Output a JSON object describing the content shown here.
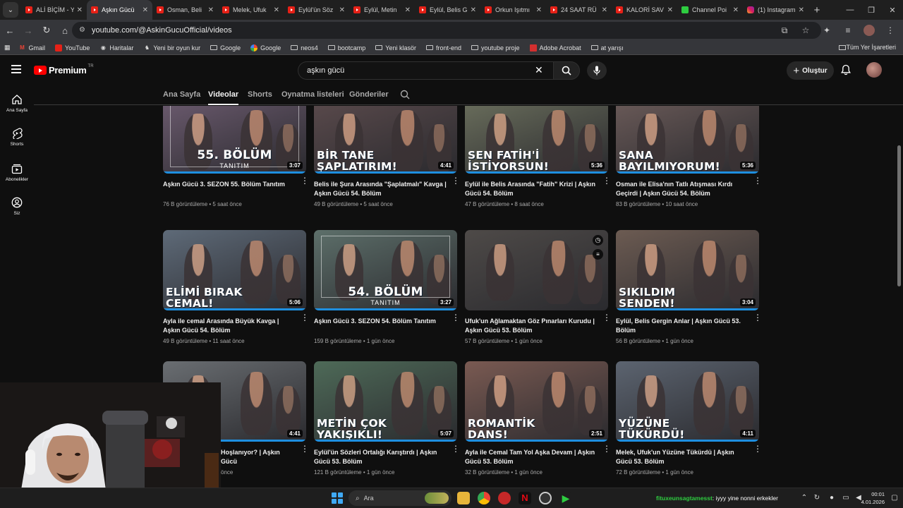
{
  "browser": {
    "tab_menu_glyph": "⌄",
    "tabs": [
      {
        "label": "ALİ BİÇİM - Y",
        "active": false,
        "icon": "youtube-icon"
      },
      {
        "label": "Aşkın Gücü",
        "active": true,
        "icon": "youtube-icon"
      },
      {
        "label": "Osman, Beli",
        "active": false,
        "icon": "youtube-icon"
      },
      {
        "label": "Melek, Ufuk",
        "active": false,
        "icon": "youtube-icon"
      },
      {
        "label": "Eylül'ün Söz",
        "active": false,
        "icon": "youtube-icon"
      },
      {
        "label": "Eylül, Metin",
        "active": false,
        "icon": "youtube-icon"
      },
      {
        "label": "Eylül, Belis G",
        "active": false,
        "icon": "youtube-icon"
      },
      {
        "label": "Orkun Işıtmı",
        "active": false,
        "icon": "youtube-icon"
      },
      {
        "label": "24 SAAT RÜ",
        "active": false,
        "icon": "youtube-icon"
      },
      {
        "label": "KALORİ SAV",
        "active": false,
        "icon": "youtube-icon"
      },
      {
        "label": "Channel Poi",
        "active": false,
        "icon": "kick-icon"
      },
      {
        "label": "(1) Instagram",
        "active": false,
        "icon": "instagram-icon"
      }
    ],
    "new_tab": "+",
    "url": "youtube.com/@AskinGucuOfficial/videos"
  },
  "bookmarks": {
    "items": [
      {
        "label": "Gmail",
        "icon": "gmail-icon"
      },
      {
        "label": "YouTube",
        "icon": "youtube-icon"
      },
      {
        "label": "Haritalar",
        "icon": "maps-icon"
      },
      {
        "label": "Yeni bir oyun kur",
        "icon": "game-icon"
      },
      {
        "label": "Google",
        "icon": "folder-icon"
      },
      {
        "label": "Google",
        "icon": "google-icon"
      },
      {
        "label": "neos4",
        "icon": "folder-icon"
      },
      {
        "label": "bootcamp",
        "icon": "folder-icon"
      },
      {
        "label": "Yeni klasör",
        "icon": "folder-icon"
      },
      {
        "label": "front-end",
        "icon": "folder-icon"
      },
      {
        "label": "youtube proje",
        "icon": "folder-icon"
      },
      {
        "label": "Adobe Acrobat",
        "icon": "pdf-icon"
      },
      {
        "label": "at yarışı",
        "icon": "folder-icon"
      }
    ],
    "all_bookmarks": "Tüm Yer İşaretleri"
  },
  "youtube": {
    "logo_text": "Premium",
    "logo_country": "TR",
    "search_query": "aşkın gücü",
    "create_label": "Oluştur",
    "guide": [
      {
        "label": "Ana Sayfa",
        "icon": "home-icon"
      },
      {
        "label": "Shorts",
        "icon": "shorts-icon"
      },
      {
        "label": "Abonelikler",
        "icon": "subscriptions-icon"
      },
      {
        "label": "Siz",
        "icon": "you-icon"
      }
    ],
    "channel_tabs": [
      "Ana Sayfa",
      "Videolar",
      "Shorts",
      "Oynatma listeleri",
      "Gönderiler"
    ],
    "active_channel_tab": "Videolar"
  },
  "videos": [
    {
      "overlay": "55. BÖLÜM",
      "overlay_sub": "TANITIM",
      "duration": "3:07",
      "title": "Aşkın Gücü 3. SEZON 55. Bölüm Tanıtım",
      "views": "76 B görüntüleme",
      "age": "5 saat önce",
      "bg": "#6b5a6e"
    },
    {
      "overlay": "BİR TANE ŞAPLATIRIM!",
      "overlay_sub": "",
      "duration": "4:41",
      "title": "Belis ile Şura Arasında \"Şaplatmalı\" Kavga | Aşkın Gücü 54. Bölüm",
      "views": "49 B görüntüleme",
      "age": "5 saat önce",
      "bg": "#5a4a4c"
    },
    {
      "overlay": "SEN FATİH'İ İSTİYORSUN!",
      "overlay_sub": "",
      "duration": "5:36",
      "title": "Eylül ile Belis Arasında \"Fatih\" Krizi | Aşkın Gücü 54. Bölüm",
      "views": "47 B görüntüleme",
      "age": "8 saat önce",
      "bg": "#6a6e5c"
    },
    {
      "overlay": "SANA BAYILMIYORUM!",
      "overlay_sub": "",
      "duration": "5:36",
      "title": "Osman ile Elisa'nın Tatlı Atışması Kırdı Geçirdi | Aşkın Gücü 54. Bölüm",
      "views": "83 B görüntüleme",
      "age": "10 saat önce",
      "bg": "#6a5a58"
    },
    {
      "overlay": "ELİMİ BIRAK CEMAL!",
      "overlay_sub": "",
      "duration": "5:06",
      "title": "Ayla ile cemal Arasında Büyük Kavga | Aşkın Gücü 54. Bölüm",
      "views": "49 B görüntüleme",
      "age": "11 saat önce",
      "bg": "#5e6a78"
    },
    {
      "overlay": "54. BÖLÜM",
      "overlay_sub": "TANITIM",
      "duration": "3:27",
      "title": "Aşkın Gücü 3. SEZON 54. Bölüm Tanıtım",
      "views": "159 B görüntüleme",
      "age": "1 gün önce",
      "bg": "#5d6f6a"
    },
    {
      "overlay": "",
      "overlay_sub": "",
      "duration": "",
      "title": "Ufuk'un Ağlamaktan Göz Pınarları Kurudu | Aşkın Gücü 53. Bölüm",
      "views": "57 B görüntüleme",
      "age": "1 gün önce",
      "bg": "#4e4a48"
    },
    {
      "overlay": "SIKILDIM SENDEN!",
      "overlay_sub": "",
      "duration": "3:04",
      "title": "Eylül, Belis Gergin Anlar | Aşkın Gücü 53. Bölüm",
      "views": "56 B görüntüleme",
      "age": "1 gün önce",
      "bg": "#6c5b52"
    },
    {
      "overlay": "ÜM",
      "overlay_sub": "",
      "duration": "4:41",
      "title": "Hoşlanıyor? | Aşkın Gücü",
      "views": "",
      "age": "önce",
      "bg": "#6a6e72"
    },
    {
      "overlay": "METİN ÇOK YAKIŞIKLI!",
      "overlay_sub": "",
      "duration": "5:07",
      "title": "Eylül'ün Sözleri Ortalığı Karıştırdı | Aşkın Gücü 53. Bölüm",
      "views": "121 B görüntüleme",
      "age": "1 gün önce",
      "bg": "#4e6a58"
    },
    {
      "overlay": "ROMANTİK DANS!",
      "overlay_sub": "",
      "duration": "2:51",
      "title": "Ayla ile Cemal Tam Yol Aşka Devam | Aşkın Gücü 53. Bölüm",
      "views": "32 B görüntüleme",
      "age": "1 gün önce",
      "bg": "#7a5a52"
    },
    {
      "overlay": "YÜZÜNE TÜKÜRDÜ!",
      "overlay_sub": "",
      "duration": "4:11",
      "title": "Melek, Ufuk'un Yüzüne Tükürdü | Aşkın Gücü 53. Bölüm",
      "views": "72 B görüntüleme",
      "age": "1 gün önce",
      "bg": "#5c6470"
    }
  ],
  "taskbar": {
    "search_placeholder": "Ara",
    "ticker_user": "fituxeunsagtamesst",
    "ticker_text": ": iyyy yine nonni erkekler",
    "time": "00:01",
    "date": "4.01.2026"
  }
}
